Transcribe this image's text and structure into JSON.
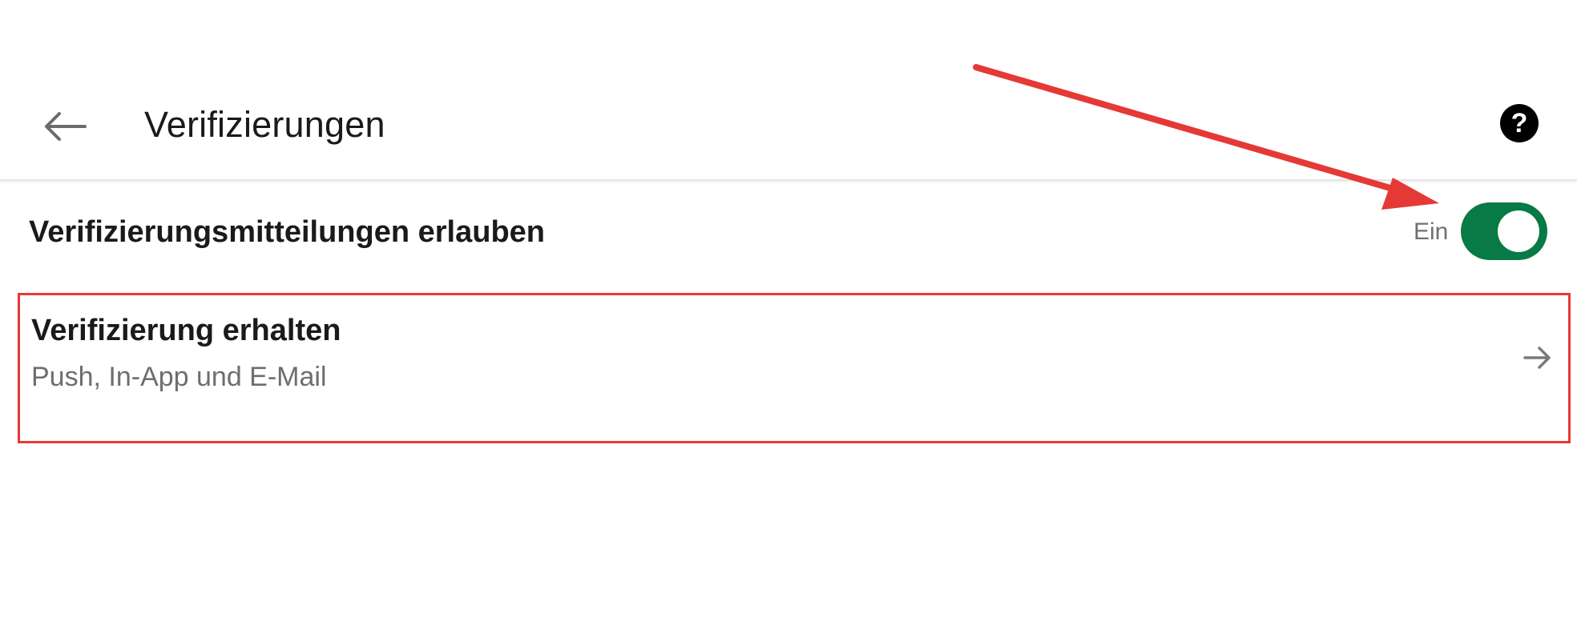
{
  "header": {
    "title": "Verifizierungen",
    "back_icon": "arrow-left-icon",
    "help_icon": "help-circle-icon",
    "help_glyph": "?"
  },
  "setting": {
    "label": "Verifizierungsmitteilungen erlauben",
    "state_text": "Ein",
    "enabled": true,
    "toggle_color": "#087a45"
  },
  "nav_item": {
    "title": "Verifizierung erhalten",
    "subtitle": "Push, In-App und E-Mail",
    "arrow_icon": "arrow-right-icon"
  },
  "annotations": {
    "highlight_color": "#e53935",
    "arrow_color": "#e53935"
  }
}
